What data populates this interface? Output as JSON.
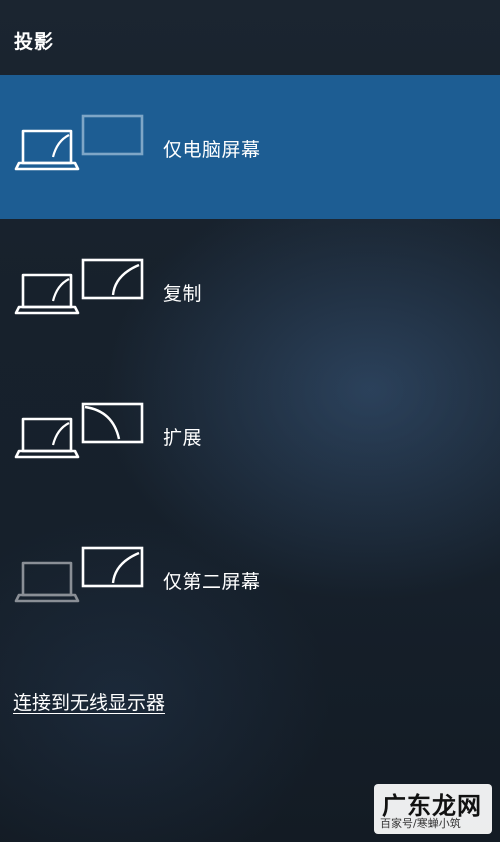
{
  "panel": {
    "title": "投影"
  },
  "options": [
    {
      "label": "仅电脑屏幕",
      "selected": true
    },
    {
      "label": "复制",
      "selected": false
    },
    {
      "label": "扩展",
      "selected": false
    },
    {
      "label": "仅第二屏幕",
      "selected": false
    }
  ],
  "connect_link": "连接到无线显示器",
  "watermark": {
    "logo": "广东龙网",
    "sub": "百家号/寒蝉小筑"
  },
  "colors": {
    "selected_bg": "#1d5d93",
    "background": "#18222d",
    "text": "#ffffff",
    "inactive_icon": "#8a8f96"
  },
  "icons": [
    "laptop-icon",
    "monitor-icon"
  ]
}
